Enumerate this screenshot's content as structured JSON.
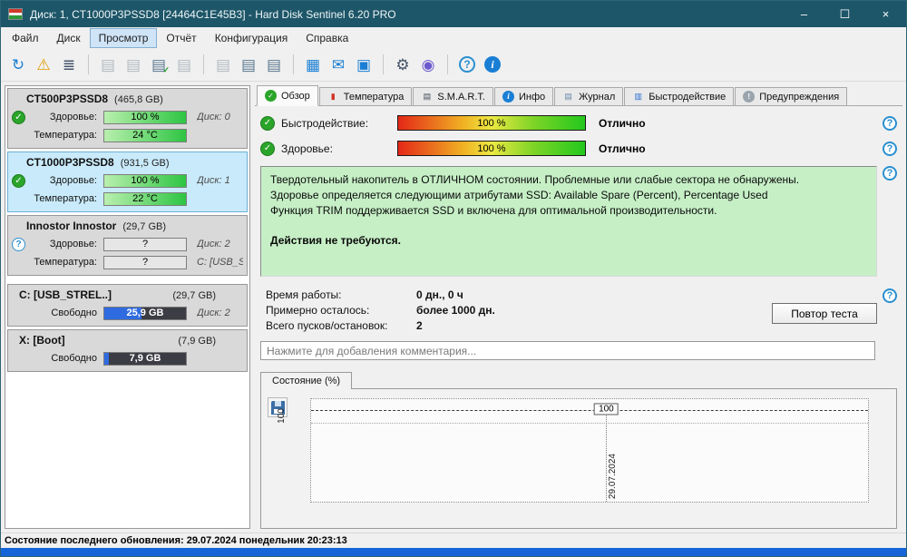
{
  "window": {
    "title": "Диск: 1, CT1000P3PSSD8 [24464C1E45B3]  -  Hard Disk Sentinel 6.20 PRO",
    "controls": {
      "minimize": "–",
      "maximize": "☐",
      "close": "×"
    }
  },
  "colors": {
    "titlebar_teal": "#1d5668",
    "selected_card_blue": "#c9eafa",
    "status_green_bg": "#c6efc6",
    "health_green": "#2ec543",
    "taskbar_blue": "#1565d8",
    "accent_blue": "#1a7fd4"
  },
  "icons": {
    "check": "✓",
    "question": "?",
    "help": "?",
    "info": "i"
  },
  "menu": {
    "items": [
      "Файл",
      "Диск",
      "Просмотр",
      "Отчёт",
      "Конфигурация",
      "Справка"
    ]
  },
  "toolbar": {
    "icons": [
      {
        "name": "refresh",
        "glyph": "↻"
      },
      {
        "name": "warning-help",
        "glyph": "⚠"
      },
      {
        "name": "test-menu",
        "glyph": "≣"
      },
      {
        "name": "disk-offline",
        "glyph": "▤"
      },
      {
        "name": "disk-schedule",
        "glyph": "▤"
      },
      {
        "name": "disk-accept",
        "glyph": "▤",
        "badge": "✓"
      },
      {
        "name": "disk-remove",
        "glyph": "▤"
      },
      {
        "name": "disk-standby",
        "glyph": "▤"
      },
      {
        "name": "disk-tools",
        "glyph": "▤"
      },
      {
        "name": "disk-drive",
        "glyph": "▤"
      },
      {
        "name": "report-notes",
        "glyph": "▦"
      },
      {
        "name": "send-mail",
        "glyph": "✉"
      },
      {
        "name": "remote-monitor",
        "glyph": "▣"
      },
      {
        "name": "settings-gear",
        "glyph": "⚙"
      },
      {
        "name": "sound-alert",
        "glyph": "◉"
      },
      {
        "name": "help",
        "glyph": "?"
      },
      {
        "name": "info",
        "glyph": "i"
      }
    ]
  },
  "sidebar": {
    "disks": [
      {
        "name": "CT500P3PSSD8",
        "size": "(465,8 GB)",
        "health_label": "Здоровье:",
        "health": "100 %",
        "disk": "Диск: 0",
        "temp_label": "Температура:",
        "temp": "24 °C"
      },
      {
        "name": "CT1000P3PSSD8",
        "size": "(931,5 GB)",
        "health_label": "Здоровье:",
        "health": "100 %",
        "disk": "Диск: 1",
        "temp_label": "Температура:",
        "temp": "22 °C"
      },
      {
        "name": "Innostor Innostor",
        "size": "(29,7 GB)",
        "health_label": "Здоровье:",
        "health": "?",
        "disk": "Диск: 2",
        "temp_label": "Температура:",
        "temp": "?",
        "extra": "C: [USB_STRE"
      }
    ],
    "partitions": [
      {
        "name": "C: [USB_STREL..]",
        "size": "(29,7 GB)",
        "free_label": "Свободно",
        "free": "25,9 GB",
        "disk": "Диск: 2"
      },
      {
        "name": "X: [Boot]",
        "size": "(7,9 GB)",
        "free_label": "Свободно",
        "free": "7,9 GB"
      }
    ]
  },
  "tabs": {
    "items": [
      {
        "label": "Обзор",
        "icon": "✓"
      },
      {
        "label": "Температура",
        "icon": "▮"
      },
      {
        "label": "S.M.A.R.T.",
        "icon": "▤"
      },
      {
        "label": "Инфо",
        "icon": "i"
      },
      {
        "label": "Журнал",
        "icon": "▤"
      },
      {
        "label": "Быстродействие",
        "icon": "▥"
      },
      {
        "label": "Предупреждения",
        "icon": "!"
      }
    ]
  },
  "overview": {
    "performance": {
      "label": "Быстродействие:",
      "value": "100 %",
      "rating": "Отлично"
    },
    "health": {
      "label": "Здоровье:",
      "value": "100 %",
      "rating": "Отлично"
    },
    "status": {
      "line1": "Твердотельный накопитель в ОТЛИЧНОМ состоянии. Проблемные или слабые сектора не обнаружены.",
      "line2": "Здоровье определяется следующими атрибутами SSD: Available Spare (Percent), Percentage Used",
      "line3": "Функция TRIM поддерживается SSD и включена для оптимальной производительности.",
      "action": "Действия не требуются."
    },
    "stats": [
      {
        "label": "Время работы:",
        "value": "0 дн., 0 ч"
      },
      {
        "label": "Примерно осталось:",
        "value": "более 1000 дн."
      },
      {
        "label": "Всего пусков/остановок:",
        "value": "2"
      }
    ],
    "retest_button": "Повтор теста",
    "comment_placeholder": "Нажмите для добавления комментария..."
  },
  "chart": {
    "tab_label": "Состояние (%)",
    "y_axis_label": "100",
    "x_axis_label": "29.07.2024",
    "point_label": "100",
    "chart_data": {
      "type": "line",
      "title": "Состояние (%)",
      "x": [
        "29.07.2024"
      ],
      "series": [
        {
          "name": "Состояние (%)",
          "values": [
            100
          ]
        }
      ],
      "ylim": [
        0,
        100
      ],
      "ytick_labels": [
        "100"
      ],
      "annotations": [
        "100"
      ],
      "grid": "dotted",
      "legend": "none"
    }
  },
  "statusbar": {
    "text": "Состояние последнего обновления: 29.07.2024 понедельник 20:23:13"
  }
}
